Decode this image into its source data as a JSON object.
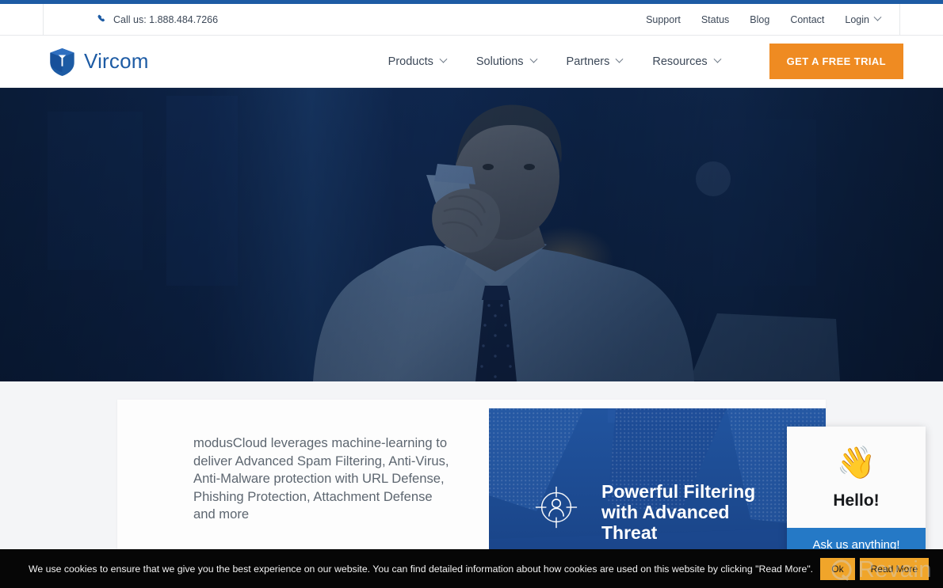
{
  "brand": {
    "name": "Vircom",
    "logo_icon": "vircom-shield-icon",
    "accent_blue": "#1d5ba4",
    "accent_orange": "#ef8b22"
  },
  "utility_bar": {
    "phone_icon": "phone-icon",
    "phone_text": "Call us: 1.888.484.7266",
    "links": [
      {
        "label": "Support"
      },
      {
        "label": "Status"
      },
      {
        "label": "Blog"
      },
      {
        "label": "Contact"
      }
    ],
    "login": {
      "label": "Login",
      "chevron_icon": "chevron-down-icon"
    }
  },
  "main_nav": {
    "items": [
      {
        "label": "Products",
        "chevron_icon": "chevron-down-icon"
      },
      {
        "label": "Solutions",
        "chevron_icon": "chevron-down-icon"
      },
      {
        "label": "Partners",
        "chevron_icon": "chevron-down-icon"
      },
      {
        "label": "Resources",
        "chevron_icon": "chevron-down-icon"
      }
    ],
    "cta_label": "GET A FREE TRIAL"
  },
  "hero": {
    "image_description": "businessman in light blue shirt and dark polka-dot tie talking on a phone at a laptop, blue tinted",
    "overlay_color": "#10284d"
  },
  "content_card": {
    "paragraph": "modusCloud leverages machine-learning to deliver Advanced Spam Filtering, Anti-Virus, Anti-Malware protection with URL Defense, Phishing Protection, Attachment Defense and more",
    "promo": {
      "icon": "target-person-icon",
      "heading": "Powerful Filtering with Advanced Threat",
      "background_color": "#1e4e9c"
    },
    "background_color": "#f4f5f7"
  },
  "chat_widget": {
    "wave_icon": "waving-hand-icon",
    "greeting": "Hello!",
    "prompt": "Ask us anything!",
    "bar_color": "#2579c6"
  },
  "cookie_banner": {
    "message": "We use cookies to ensure that we give you the best experience on our website. You can find detailed information about how cookies are used on this website by clicking \"Read More\".",
    "ok_label": "Ok",
    "read_more_label": "Read More",
    "button_color": "#f0a52a"
  },
  "watermark": {
    "text": "Revain",
    "mark_icon": "revain-logo-icon"
  }
}
